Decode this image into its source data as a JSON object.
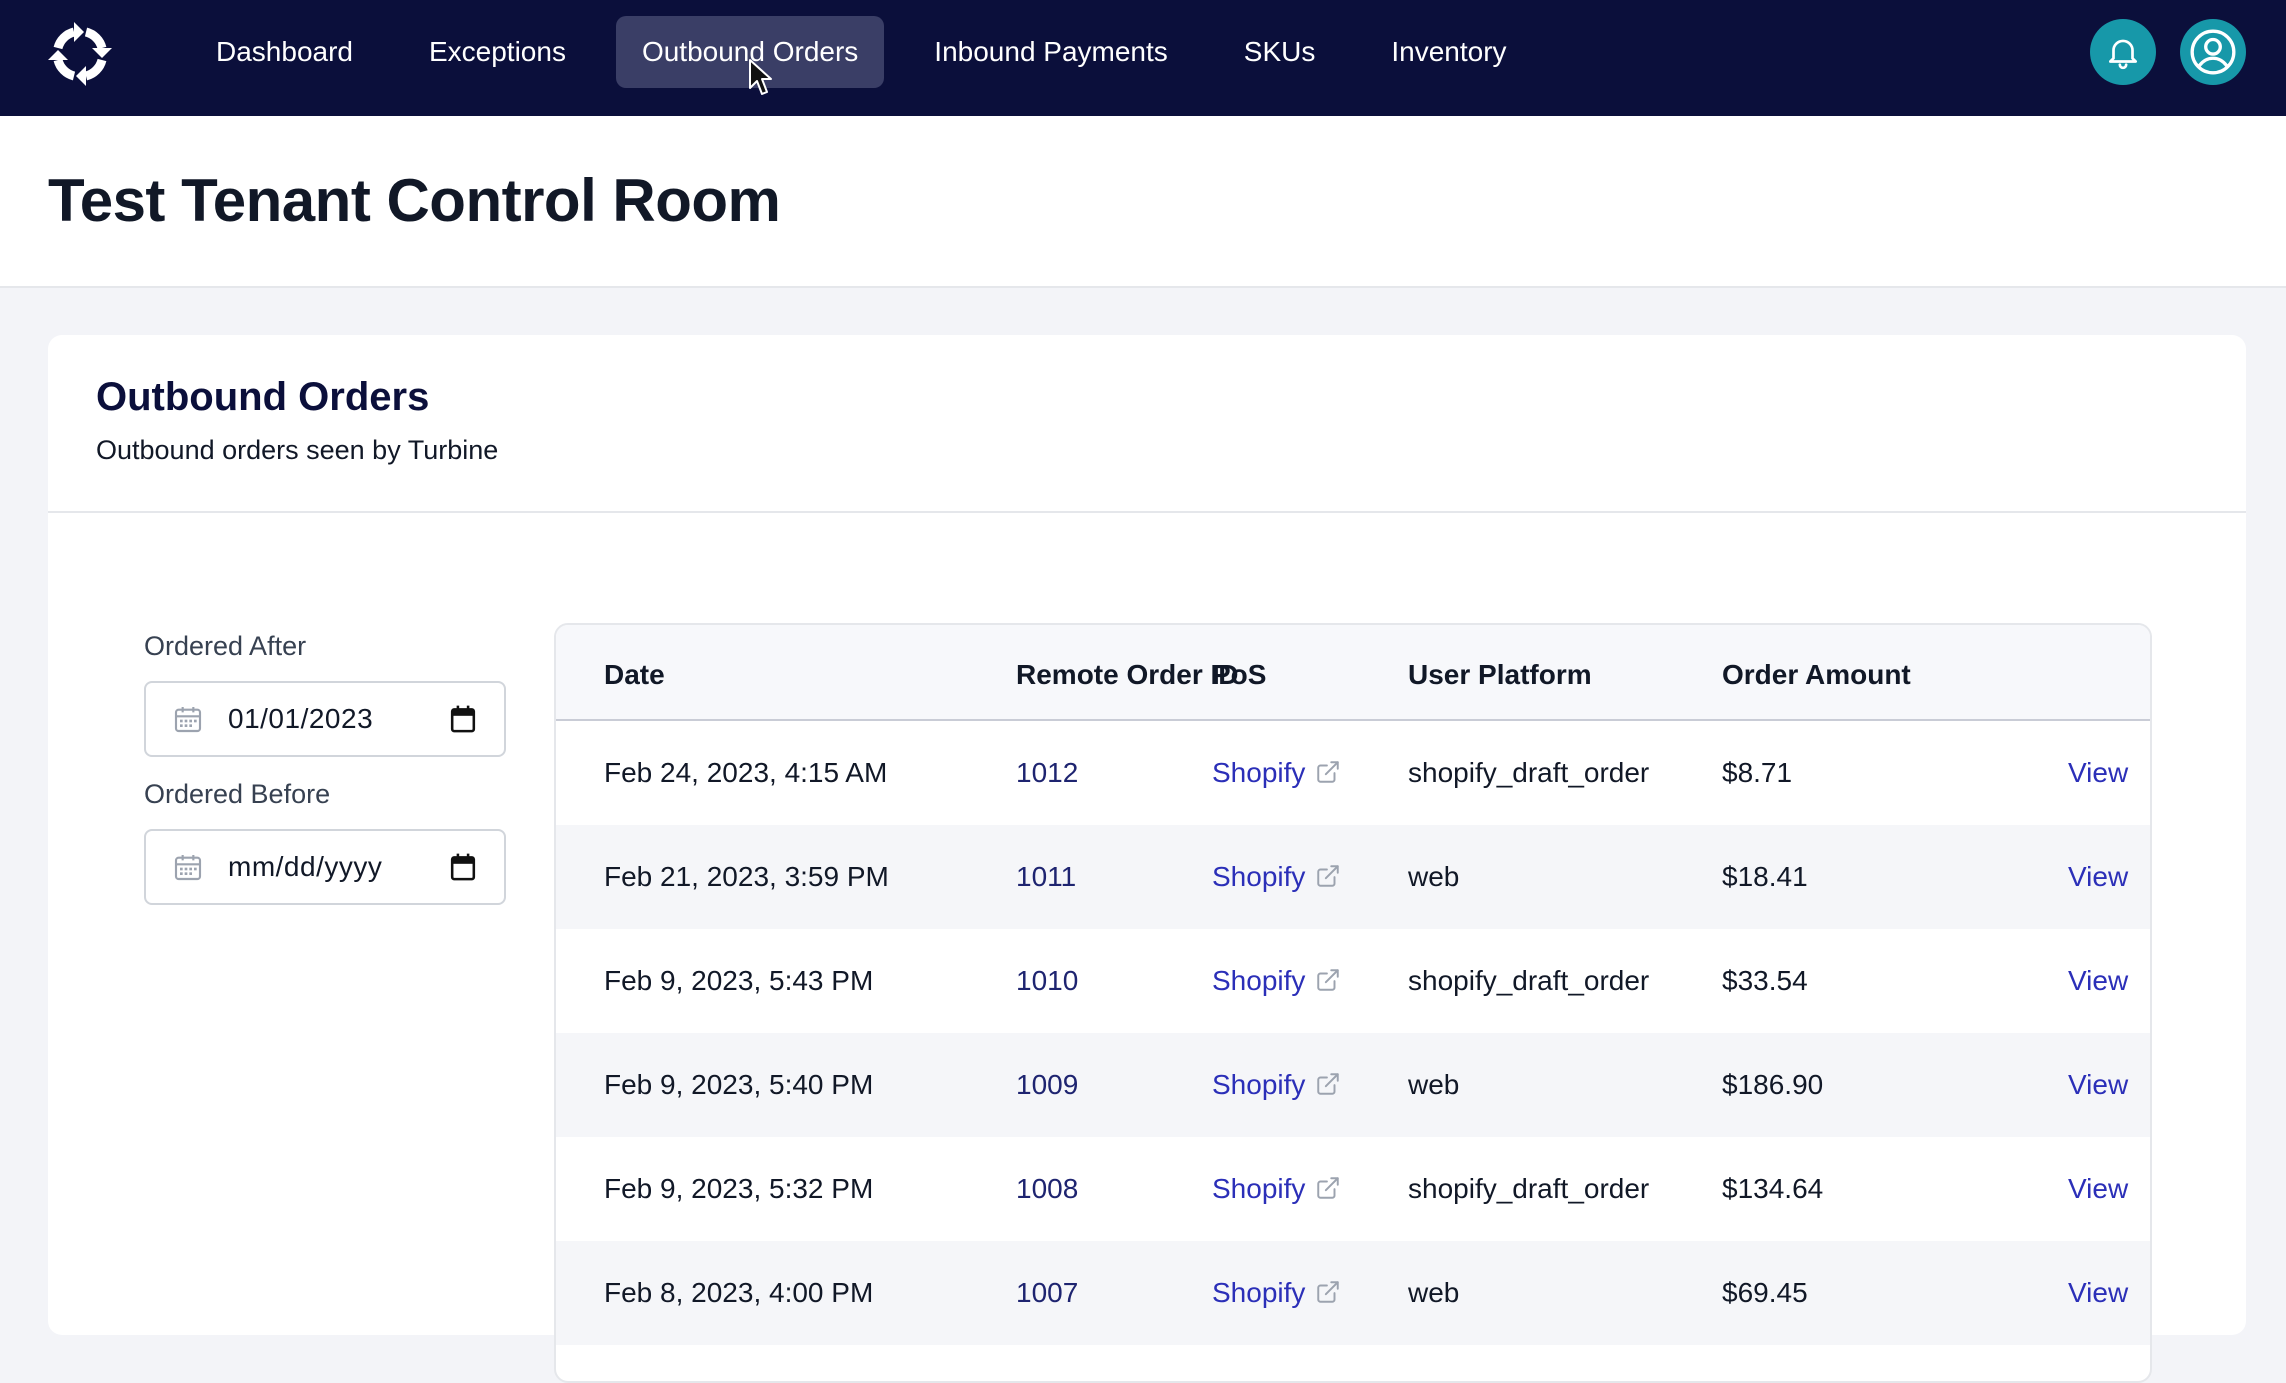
{
  "nav": {
    "items": [
      {
        "label": "Dashboard",
        "active": false
      },
      {
        "label": "Exceptions",
        "active": false
      },
      {
        "label": "Outbound Orders",
        "active": true
      },
      {
        "label": "Inbound Payments",
        "active": false
      },
      {
        "label": "SKUs",
        "active": false
      },
      {
        "label": "Inventory",
        "active": false
      }
    ],
    "notification_icon": "bell-icon",
    "profile_icon": "user-circle-icon"
  },
  "page": {
    "title": "Test Tenant Control Room"
  },
  "card": {
    "title": "Outbound Orders",
    "subtitle": "Outbound orders seen by Turbine"
  },
  "filters": {
    "ordered_after": {
      "label": "Ordered After",
      "value": "01/01/2023"
    },
    "ordered_before": {
      "label": "Ordered Before",
      "value": "",
      "placeholder": "mm/dd/yyyy"
    }
  },
  "table": {
    "columns": [
      "Date",
      "Remote Order ID",
      "PoS",
      "User Platform",
      "Order Amount"
    ],
    "rows": [
      {
        "date": "Feb 24, 2023, 4:15 AM",
        "id": "1012",
        "pos": "Shopify",
        "platform": "shopify_draft_order",
        "amount": "$8.71",
        "action": "View"
      },
      {
        "date": "Feb 21, 2023, 3:59 PM",
        "id": "1011",
        "pos": "Shopify",
        "platform": "web",
        "amount": "$18.41",
        "action": "View"
      },
      {
        "date": "Feb 9, 2023, 5:43 PM",
        "id": "1010",
        "pos": "Shopify",
        "platform": "shopify_draft_order",
        "amount": "$33.54",
        "action": "View"
      },
      {
        "date": "Feb 9, 2023, 5:40 PM",
        "id": "1009",
        "pos": "Shopify",
        "platform": "web",
        "amount": "$186.90",
        "action": "View"
      },
      {
        "date": "Feb 9, 2023, 5:32 PM",
        "id": "1008",
        "pos": "Shopify",
        "platform": "shopify_draft_order",
        "amount": "$134.64",
        "action": "View"
      },
      {
        "date": "Feb 8, 2023, 4:00 PM",
        "id": "1007",
        "pos": "Shopify",
        "platform": "web",
        "amount": "$69.45",
        "action": "View"
      }
    ]
  },
  "colors": {
    "nav_bg": "#0b0f3b",
    "nav_active_bg": "#3a3e66",
    "accent_teal": "#1798a9",
    "link": "#2b2fb8"
  }
}
